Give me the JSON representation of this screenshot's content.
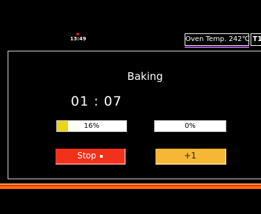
{
  "status_bar": {
    "clock": "13:49",
    "oven_temp_label": "Oven Temp.",
    "oven_temp_value": "242℃",
    "tab_label": "T1"
  },
  "main": {
    "title": "Baking",
    "timer": "01 : 07",
    "progress_1": {
      "label": "16%",
      "value_percent": 16,
      "fill_color": "#ecd515"
    },
    "progress_2": {
      "label": "0%",
      "value_percent": 0,
      "fill_color": "#ecd515"
    },
    "stop_button_label": "Stop",
    "plus_button_label": "+1"
  },
  "colors": {
    "stop_button": "#f2311a",
    "plus_button": "#f6b636",
    "temp_underline": "#b15bd0",
    "clock_indicator": "#e0191c"
  },
  "icons": {
    "clock_indicator": "red-dot-icon",
    "stop": "stop-square-icon"
  }
}
